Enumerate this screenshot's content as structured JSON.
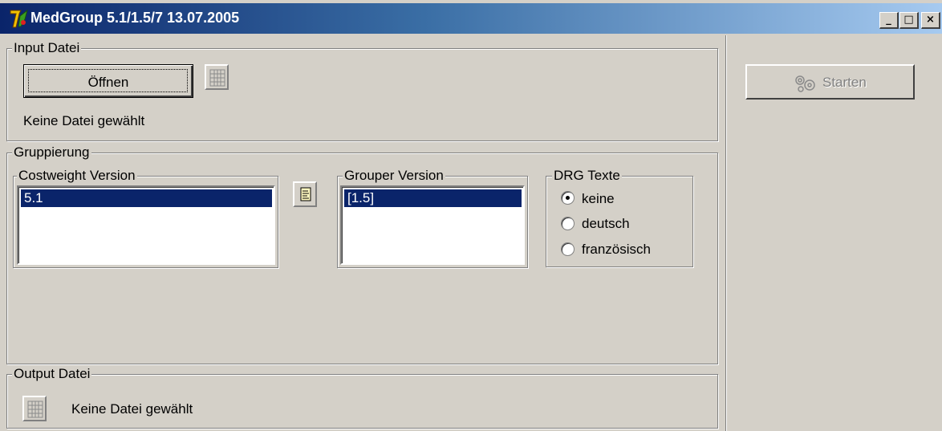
{
  "window": {
    "title": "MedGroup 5.1/1.5/7 13.07.2005",
    "caption_buttons": {
      "minimize": "_",
      "maximize": "□",
      "close": "×"
    },
    "app_icon": "medgroup-logo-icon"
  },
  "input_group": {
    "legend": "Input Datei",
    "open_button": "Öffnen",
    "file_status": "Keine Datei gewählt",
    "browse_icon": "grid-icon"
  },
  "grouping_group": {
    "legend": "Gruppierung",
    "costweight": {
      "legend": "Costweight Version",
      "items": [
        "5.1"
      ],
      "selected": "5.1"
    },
    "info_icon": "document-icon",
    "grouper": {
      "legend": "Grouper Version",
      "items": [
        "[1.5]"
      ],
      "selected": "[1.5]"
    },
    "drg_texts": {
      "legend": "DRG Texte",
      "options": [
        {
          "label": "keine",
          "checked": true
        },
        {
          "label": "deutsch",
          "checked": false
        },
        {
          "label": "französisch",
          "checked": false
        }
      ]
    }
  },
  "output_group": {
    "legend": "Output Datei",
    "file_status": "Keine Datei gewählt",
    "browse_icon": "grid-icon"
  },
  "actions": {
    "start_button": "Starten",
    "start_icon": "gears-icon",
    "start_enabled": false
  },
  "colors": {
    "face": "#d4d0c8",
    "title_start": "#0a246a",
    "title_end": "#a6caf0",
    "selection": "#0a246a"
  }
}
